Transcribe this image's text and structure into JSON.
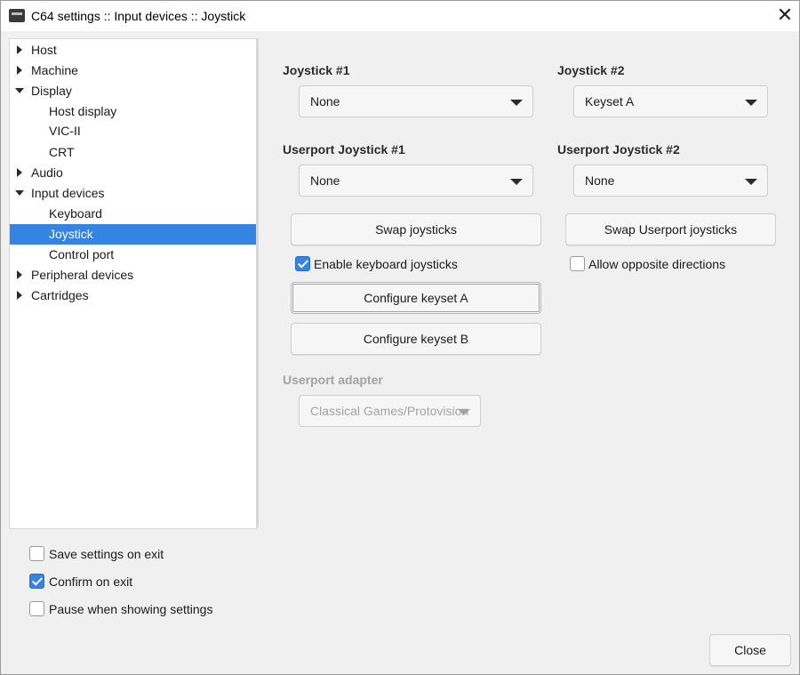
{
  "window": {
    "title": "C64 settings :: Input devices :: Joystick",
    "close_glyph": "✕"
  },
  "tree": {
    "items": [
      {
        "label": "Host",
        "expander": "collapsed"
      },
      {
        "label": "Machine",
        "expander": "collapsed"
      },
      {
        "label": "Display",
        "expander": "expanded"
      },
      {
        "label": "Host display",
        "expander": "none"
      },
      {
        "label": "VIC-II",
        "expander": "none"
      },
      {
        "label": "CRT",
        "expander": "none"
      },
      {
        "label": "Audio",
        "expander": "collapsed"
      },
      {
        "label": "Input devices",
        "expander": "expanded"
      },
      {
        "label": "Keyboard",
        "expander": "none"
      },
      {
        "label": "Joystick",
        "expander": "none",
        "selected": true
      },
      {
        "label": "Control port",
        "expander": "none"
      },
      {
        "label": "Peripheral devices",
        "expander": "collapsed"
      },
      {
        "label": "Cartridges",
        "expander": "collapsed"
      }
    ]
  },
  "joystick1": {
    "label": "Joystick #1",
    "value": "None"
  },
  "joystick2": {
    "label": "Joystick #2",
    "value": "Keyset A"
  },
  "userport1": {
    "label": "Userport Joystick #1",
    "value": "None"
  },
  "userport2": {
    "label": "Userport Joystick #2",
    "value": "None"
  },
  "buttons": {
    "swap_joysticks": "Swap joysticks",
    "swap_userport": "Swap Userport joysticks",
    "configure_a": "Configure keyset A",
    "configure_b": "Configure keyset B",
    "close": "Close"
  },
  "options": {
    "enable_keyboard": {
      "label": "Enable keyboard joysticks",
      "checked": true
    },
    "allow_opposite": {
      "label": "Allow opposite directions",
      "checked": false
    }
  },
  "userport_adapter": {
    "label": "Userport adapter",
    "value": "Classical Games/Protovision",
    "enabled": false
  },
  "footer": {
    "save_on_exit": {
      "label": "Save settings on exit",
      "checked": false
    },
    "confirm_on_exit": {
      "label": "Confirm on exit",
      "checked": true
    },
    "pause_showing": {
      "label": "Pause when showing settings",
      "checked": false
    }
  },
  "colors": {
    "selection": "#3584e4",
    "background": "#f0f0f0"
  }
}
